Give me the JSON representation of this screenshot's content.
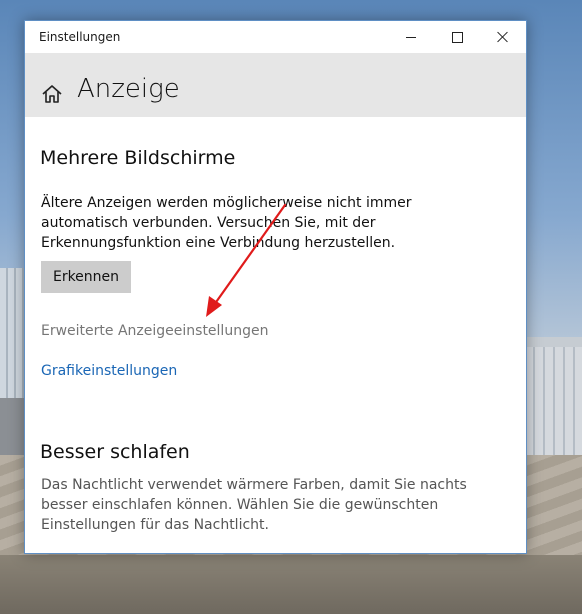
{
  "window": {
    "title": "Einstellungen",
    "controls": {
      "minimize": "minimize-icon",
      "maximize": "maximize-icon",
      "close": "close-icon"
    }
  },
  "header": {
    "home_icon": "home-icon",
    "title": "Anzeige"
  },
  "multi_display": {
    "heading": "Mehrere Bildschirme",
    "description": "Ältere Anzeigen werden möglicherweise nicht immer automatisch verbunden. Versuchen Sie, mit der Erkennungsfunktion eine Verbindung herzustellen.",
    "detect_button": "Erkennen",
    "advanced_link": "Erweiterte Anzeigeeinstellungen",
    "graphics_link": "Grafikeinstellungen"
  },
  "night_light": {
    "heading": "Besser schlafen",
    "description": "Das Nachtlicht verwendet wärmere Farben, damit Sie nachts besser einschlafen können. Wählen Sie die gewünschten Einstellungen für das Nachtlicht."
  },
  "colors": {
    "accent_link": "#1a66b5",
    "annotation_arrow": "#e01b1b",
    "header_bg": "#e6e6e6",
    "button_bg": "#cccccc"
  }
}
